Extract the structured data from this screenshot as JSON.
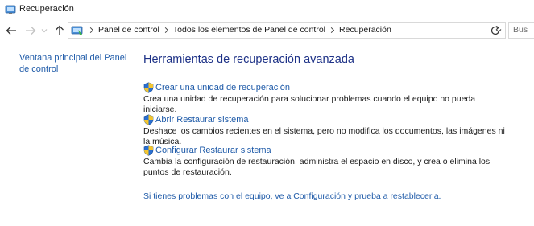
{
  "window": {
    "title": "Recuperación",
    "title_icon": "control-panel-icon"
  },
  "address_bar": {
    "breadcrumbs": [
      "Panel de control",
      "Todos los elementos de Panel de control",
      "Recuperación"
    ],
    "search_placeholder": "Bus"
  },
  "sidebar": {
    "home_link": "Ventana principal del Panel de control"
  },
  "main": {
    "heading": "Herramientas de recuperación avanzada",
    "tasks": [
      {
        "label": "Crear una unidad de recuperación",
        "description": "Crea una unidad de recuperación para solucionar problemas cuando el equipo no pueda iniciarse.",
        "icon": "uac-shield-icon"
      },
      {
        "label": "Abrir Restaurar sistema",
        "description": "Deshace los cambios recientes en el sistema, pero no modifica los documentos, las imágenes ni la música.",
        "icon": "uac-shield-icon"
      },
      {
        "label": "Configurar Restaurar sistema",
        "description": "Cambia la configuración de restauración, administra el espacio en disco, y crea o elimina los puntos de restauración.",
        "icon": "uac-shield-icon"
      }
    ],
    "help_link": "Si tienes problemas con el equipo, ve a Configuración y prueba a restablecerla."
  },
  "colors": {
    "link": "#1e5aa8",
    "heading": "#1e3287",
    "text": "#1a1a1a"
  }
}
